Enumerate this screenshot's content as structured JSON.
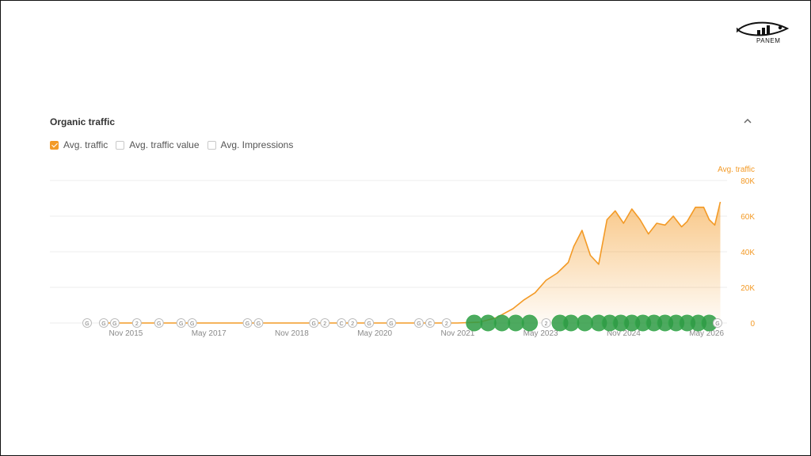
{
  "brand": {
    "name": "PANEM"
  },
  "card": {
    "title": "Organic traffic"
  },
  "toggles": [
    {
      "label": "Avg. traffic",
      "checked": true
    },
    {
      "label": "Avg. traffic value",
      "checked": false
    },
    {
      "label": "Avg. Impressions",
      "checked": false
    }
  ],
  "colors": {
    "accent": "#f39a26",
    "marker_green": "#2e9b44",
    "grid": "#ececec"
  },
  "icons": {
    "collapse": "chevron-up-icon",
    "logo": "fish-logo-icon"
  },
  "chart_data": {
    "type": "area",
    "ylabel": "Avg. traffic",
    "ylim": [
      0,
      80000
    ],
    "yticks": [
      "0",
      "20K",
      "40K",
      "60K",
      "80K"
    ],
    "xticks": [
      "Nov 2015",
      "May 2017",
      "Nov 2018",
      "May 2020",
      "Nov 2021",
      "May 2023",
      "Nov 2024",
      "May 2026"
    ],
    "grid": true,
    "x": [
      2015.5,
      2021.9,
      2022.3,
      2022.6,
      2022.9,
      2023.1,
      2023.3,
      2023.5,
      2023.7,
      2023.9,
      2024.0,
      2024.15,
      2024.3,
      2024.45,
      2024.6,
      2024.75,
      2024.9,
      2025.05,
      2025.2,
      2025.35,
      2025.5,
      2025.65,
      2025.8,
      2025.95,
      2026.05,
      2026.2,
      2026.35,
      2026.45,
      2026.55,
      2026.65
    ],
    "values": [
      0,
      0,
      500,
      3000,
      8000,
      13000,
      17000,
      24000,
      28000,
      34000,
      43000,
      52000,
      38000,
      33000,
      58000,
      63000,
      56000,
      64000,
      58000,
      50000,
      56000,
      55000,
      60000,
      54000,
      57000,
      65000,
      65000,
      58000,
      55000,
      68000
    ],
    "event_markers": {
      "x": [
        2015.2,
        2015.5,
        2015.7,
        2016.1,
        2016.5,
        2016.9,
        2017.1,
        2018.1,
        2018.3,
        2019.3,
        2019.5,
        2019.8,
        2020.0,
        2020.3,
        2020.7,
        2021.2,
        2021.4,
        2021.7,
        2022.2,
        2022.45,
        2022.7,
        2022.95,
        2023.2,
        2023.5,
        2023.75,
        2023.95,
        2024.2,
        2024.45,
        2024.65,
        2024.85,
        2025.05,
        2025.25,
        2025.45,
        2025.65,
        2025.85,
        2026.05,
        2026.25,
        2026.45,
        2026.6
      ],
      "labels": [
        "G",
        "G",
        "G",
        "2",
        "G",
        "G",
        "G",
        "G",
        "G",
        "G",
        "2",
        "C",
        "2",
        "G",
        "G",
        "G",
        "C",
        "2",
        "",
        "",
        "",
        "",
        "",
        "2",
        "",
        "",
        "",
        "",
        "",
        "",
        "",
        "",
        "",
        "",
        "",
        "",
        "",
        "",
        "G"
      ],
      "kinds": [
        "update",
        "update",
        "update",
        "update",
        "update",
        "update",
        "update",
        "update",
        "update",
        "update",
        "update",
        "update",
        "update",
        "update",
        "update",
        "update",
        "update",
        "update",
        "ranking",
        "ranking",
        "ranking",
        "ranking",
        "ranking",
        "update",
        "ranking",
        "ranking",
        "ranking",
        "ranking",
        "ranking",
        "ranking",
        "ranking",
        "ranking",
        "ranking",
        "ranking",
        "ranking",
        "ranking",
        "ranking",
        "ranking",
        "update"
      ]
    }
  }
}
